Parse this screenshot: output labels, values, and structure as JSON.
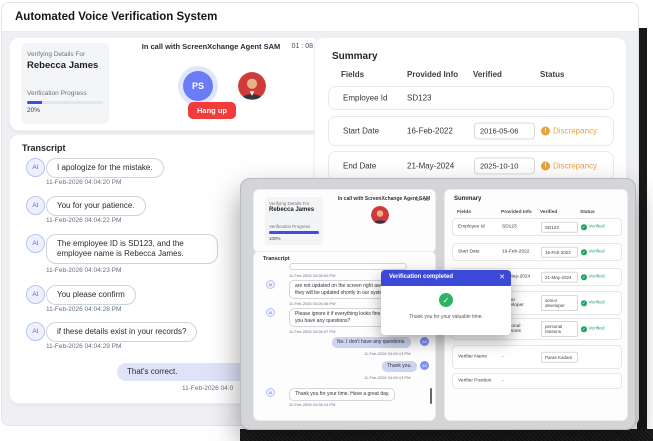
{
  "app": {
    "title": "Automated Voice Verification System"
  },
  "colors": {
    "accent_blue": "#3D4FE0",
    "danger_red": "#F23B3B",
    "warning_orange": "#E9A23B",
    "success_green": "#23A565",
    "dialog_header_blue": "#3B49D6"
  },
  "call": {
    "verifying_label": "Verifying Details For",
    "person_name": "Rebecca James",
    "progress_label": "Verification Progress",
    "progress_percent": "20%",
    "status_text": "In call with ScreenXchange Agent SAM",
    "timer": "01 : 08",
    "agent_initials": "PS",
    "hangup_label": "Hang up"
  },
  "transcript": {
    "title": "Transcript",
    "ai_avatar": "AI",
    "messages": [
      {
        "sender": "ai",
        "text": "I apologize for the mistake.",
        "time": "11-Feb-2026 04:04:20 PM"
      },
      {
        "sender": "ai",
        "text": "You for your patience.",
        "time": "11-Feb-2026 04:04:22 PM"
      },
      {
        "sender": "ai",
        "text": "The employee ID is SD123, and the employee name is Rebecca James.",
        "time": "11-Feb-2026 04:04:23 PM"
      },
      {
        "sender": "ai",
        "text": "You please confirm",
        "time": "11-Feb-2026 04:04:28 PM"
      },
      {
        "sender": "ai",
        "text": "if these details exist in your records?",
        "time": "11-Feb-2026 04:04:29 PM"
      },
      {
        "sender": "user",
        "text": "That's correct.",
        "time": "11-Feb-2026 04:0"
      }
    ]
  },
  "summary": {
    "title": "Summary",
    "headers": {
      "fields": "Fields",
      "provided": "Provided Info",
      "verified": "Verified",
      "status": "Status"
    },
    "discrepancy_icon": "!",
    "rows": [
      {
        "field": "Employee Id",
        "provided": "SD123",
        "verified": "",
        "status": ""
      },
      {
        "field": "Start Date",
        "provided": "16-Feb-2022",
        "verified": "2016-05-06",
        "status": "Discrepancy"
      },
      {
        "field": "End Date",
        "provided": "21-May-2024",
        "verified": "2025-10-10",
        "status": "Discrepancy"
      }
    ]
  },
  "modal": {
    "call": {
      "verifying_label": "Verifying Details For",
      "person_name": "Rebecca James",
      "progress_label": "Verification Progress",
      "progress_percent": "100%",
      "status_text": "In call with ScreenXchange Agent SAM",
      "timer": "02 : 31"
    },
    "transcript": {
      "title": "Transcript",
      "ai_avatar": "AI",
      "user_initials": "AS",
      "messages": [
        {
          "sender": "ai",
          "text": "",
          "time": "11-Feb-2026 04:06:00 PM"
        },
        {
          "sender": "ai",
          "text": "are not updated on the screen right away, they will be updated shortly in our system.",
          "time": "11-Feb-2026 04:06:06 PM"
        },
        {
          "sender": "ai",
          "text": "Please ignore it if everything looks fine. Do you have any questions?",
          "time": "11-Feb-2026 04:06:07 PM"
        },
        {
          "sender": "user",
          "text": "No. I don't have any questions.",
          "time": "11-Feb-2026 04:06:13 PM"
        },
        {
          "sender": "user",
          "text": "Thank you.",
          "time": "11-Feb-2026 04:06:13 PM"
        },
        {
          "sender": "ai",
          "text": "Thank you for your time. Have a great day.",
          "time": "11-Feb-2026 04:06:14 PM"
        }
      ]
    },
    "summary": {
      "title": "Summary",
      "headers": {
        "fields": "Fields",
        "provided": "Provided Info",
        "verified": "Verified",
        "status": "Status"
      },
      "rows": [
        {
          "field": "Employee Id",
          "provided": "SD123",
          "verified": "SD123",
          "status": "Verified"
        },
        {
          "field": "Start Date",
          "provided": "16-Feb-2022",
          "verified": "16-Feb-2022",
          "status": "Verified"
        },
        {
          "field": "End Date",
          "provided": "21-May-2024",
          "verified": "21-May-2024",
          "status": "Verified"
        },
        {
          "field": "Position",
          "provided": "senior Developer",
          "verified": "senior developer",
          "status": "Verified"
        },
        {
          "field": "Reason",
          "provided": "personal Reasons",
          "verified": "personal reasons",
          "status": "Verified"
        },
        {
          "field": "Verifier Name",
          "provided": "-",
          "verified": "Paras Kadam",
          "status": ""
        },
        {
          "field": "Verifier Position",
          "provided": "-",
          "verified": "",
          "status": ""
        }
      ]
    },
    "dialog": {
      "title": "Verification completed",
      "close_icon": "✕",
      "check_icon": "✓",
      "message": "Thank you for your valuable time."
    }
  }
}
